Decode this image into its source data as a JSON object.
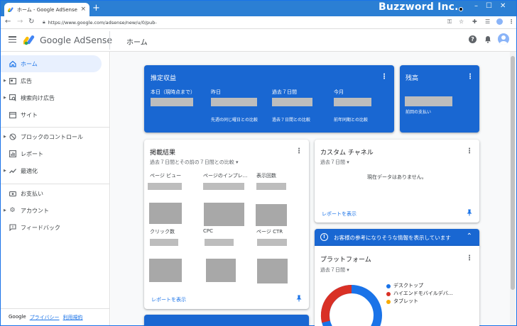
{
  "browser": {
    "tab_title": "ホーム - Google AdSense",
    "new_tab": "+",
    "url": "https://www.google.com/adsense/new/u/0/pub-",
    "brand_watermark": "Buzzword Inc."
  },
  "header": {
    "app_name": "Google AdSense",
    "page_title": "ホーム"
  },
  "sidebar": {
    "items": [
      {
        "label": "ホーム",
        "icon": "home-icon",
        "active": true
      },
      {
        "label": "広告",
        "icon": "ads-icon"
      },
      {
        "label": "検索向け広告",
        "icon": "search-ads-icon"
      },
      {
        "label": "サイト",
        "icon": "sites-icon"
      },
      {
        "label": "ブロックのコントロール",
        "icon": "block-icon"
      },
      {
        "label": "レポート",
        "icon": "report-icon"
      },
      {
        "label": "最適化",
        "icon": "optimize-icon"
      },
      {
        "label": "お支払い",
        "icon": "payments-icon"
      },
      {
        "label": "アカウント",
        "icon": "account-gear-icon"
      },
      {
        "label": "フィードバック",
        "icon": "feedback-icon"
      }
    ],
    "footer": {
      "google": "Google",
      "privacy": "プライバシー",
      "terms": "利用規約"
    }
  },
  "earnings": {
    "title": "推定収益",
    "cols": [
      {
        "label": "本日（現時点まで）",
        "note": ""
      },
      {
        "label": "昨日",
        "note": "先週の同じ曜日との比較"
      },
      {
        "label": "過去７日間",
        "note": "過去７日間との比較"
      },
      {
        "label": "今月",
        "note": "前年同期との比較"
      }
    ]
  },
  "balance": {
    "title": "残高",
    "note": "前回の支払い"
  },
  "performance": {
    "title": "掲載結果",
    "period": "過去７日間とその前の７日間との比較",
    "metrics_top": [
      "ページ ビュー",
      "ページのインプレ...",
      "表示回数"
    ],
    "metrics_bottom": [
      "クリック数",
      "CPC",
      "ページ CTR"
    ],
    "link": "レポートを表示"
  },
  "custom_channels": {
    "title": "カスタム チャネル",
    "period": "過去７日間",
    "empty": "現在データはありません。",
    "link": "レポートを表示"
  },
  "banner": {
    "text": "お客様の参考になりそうな情報を表示しています"
  },
  "platform": {
    "title": "プラットフォーム",
    "period": "過去７日間",
    "legend": [
      {
        "label": "デスクトップ",
        "color": "#1a73e8"
      },
      {
        "label": "ハイエンドモバイルデバ...",
        "color": "#d93025"
      },
      {
        "label": "タブレット",
        "color": "#f9ab00"
      }
    ]
  },
  "colors": {
    "accent": "#1a73e8",
    "card_blue": "#1967d2"
  }
}
